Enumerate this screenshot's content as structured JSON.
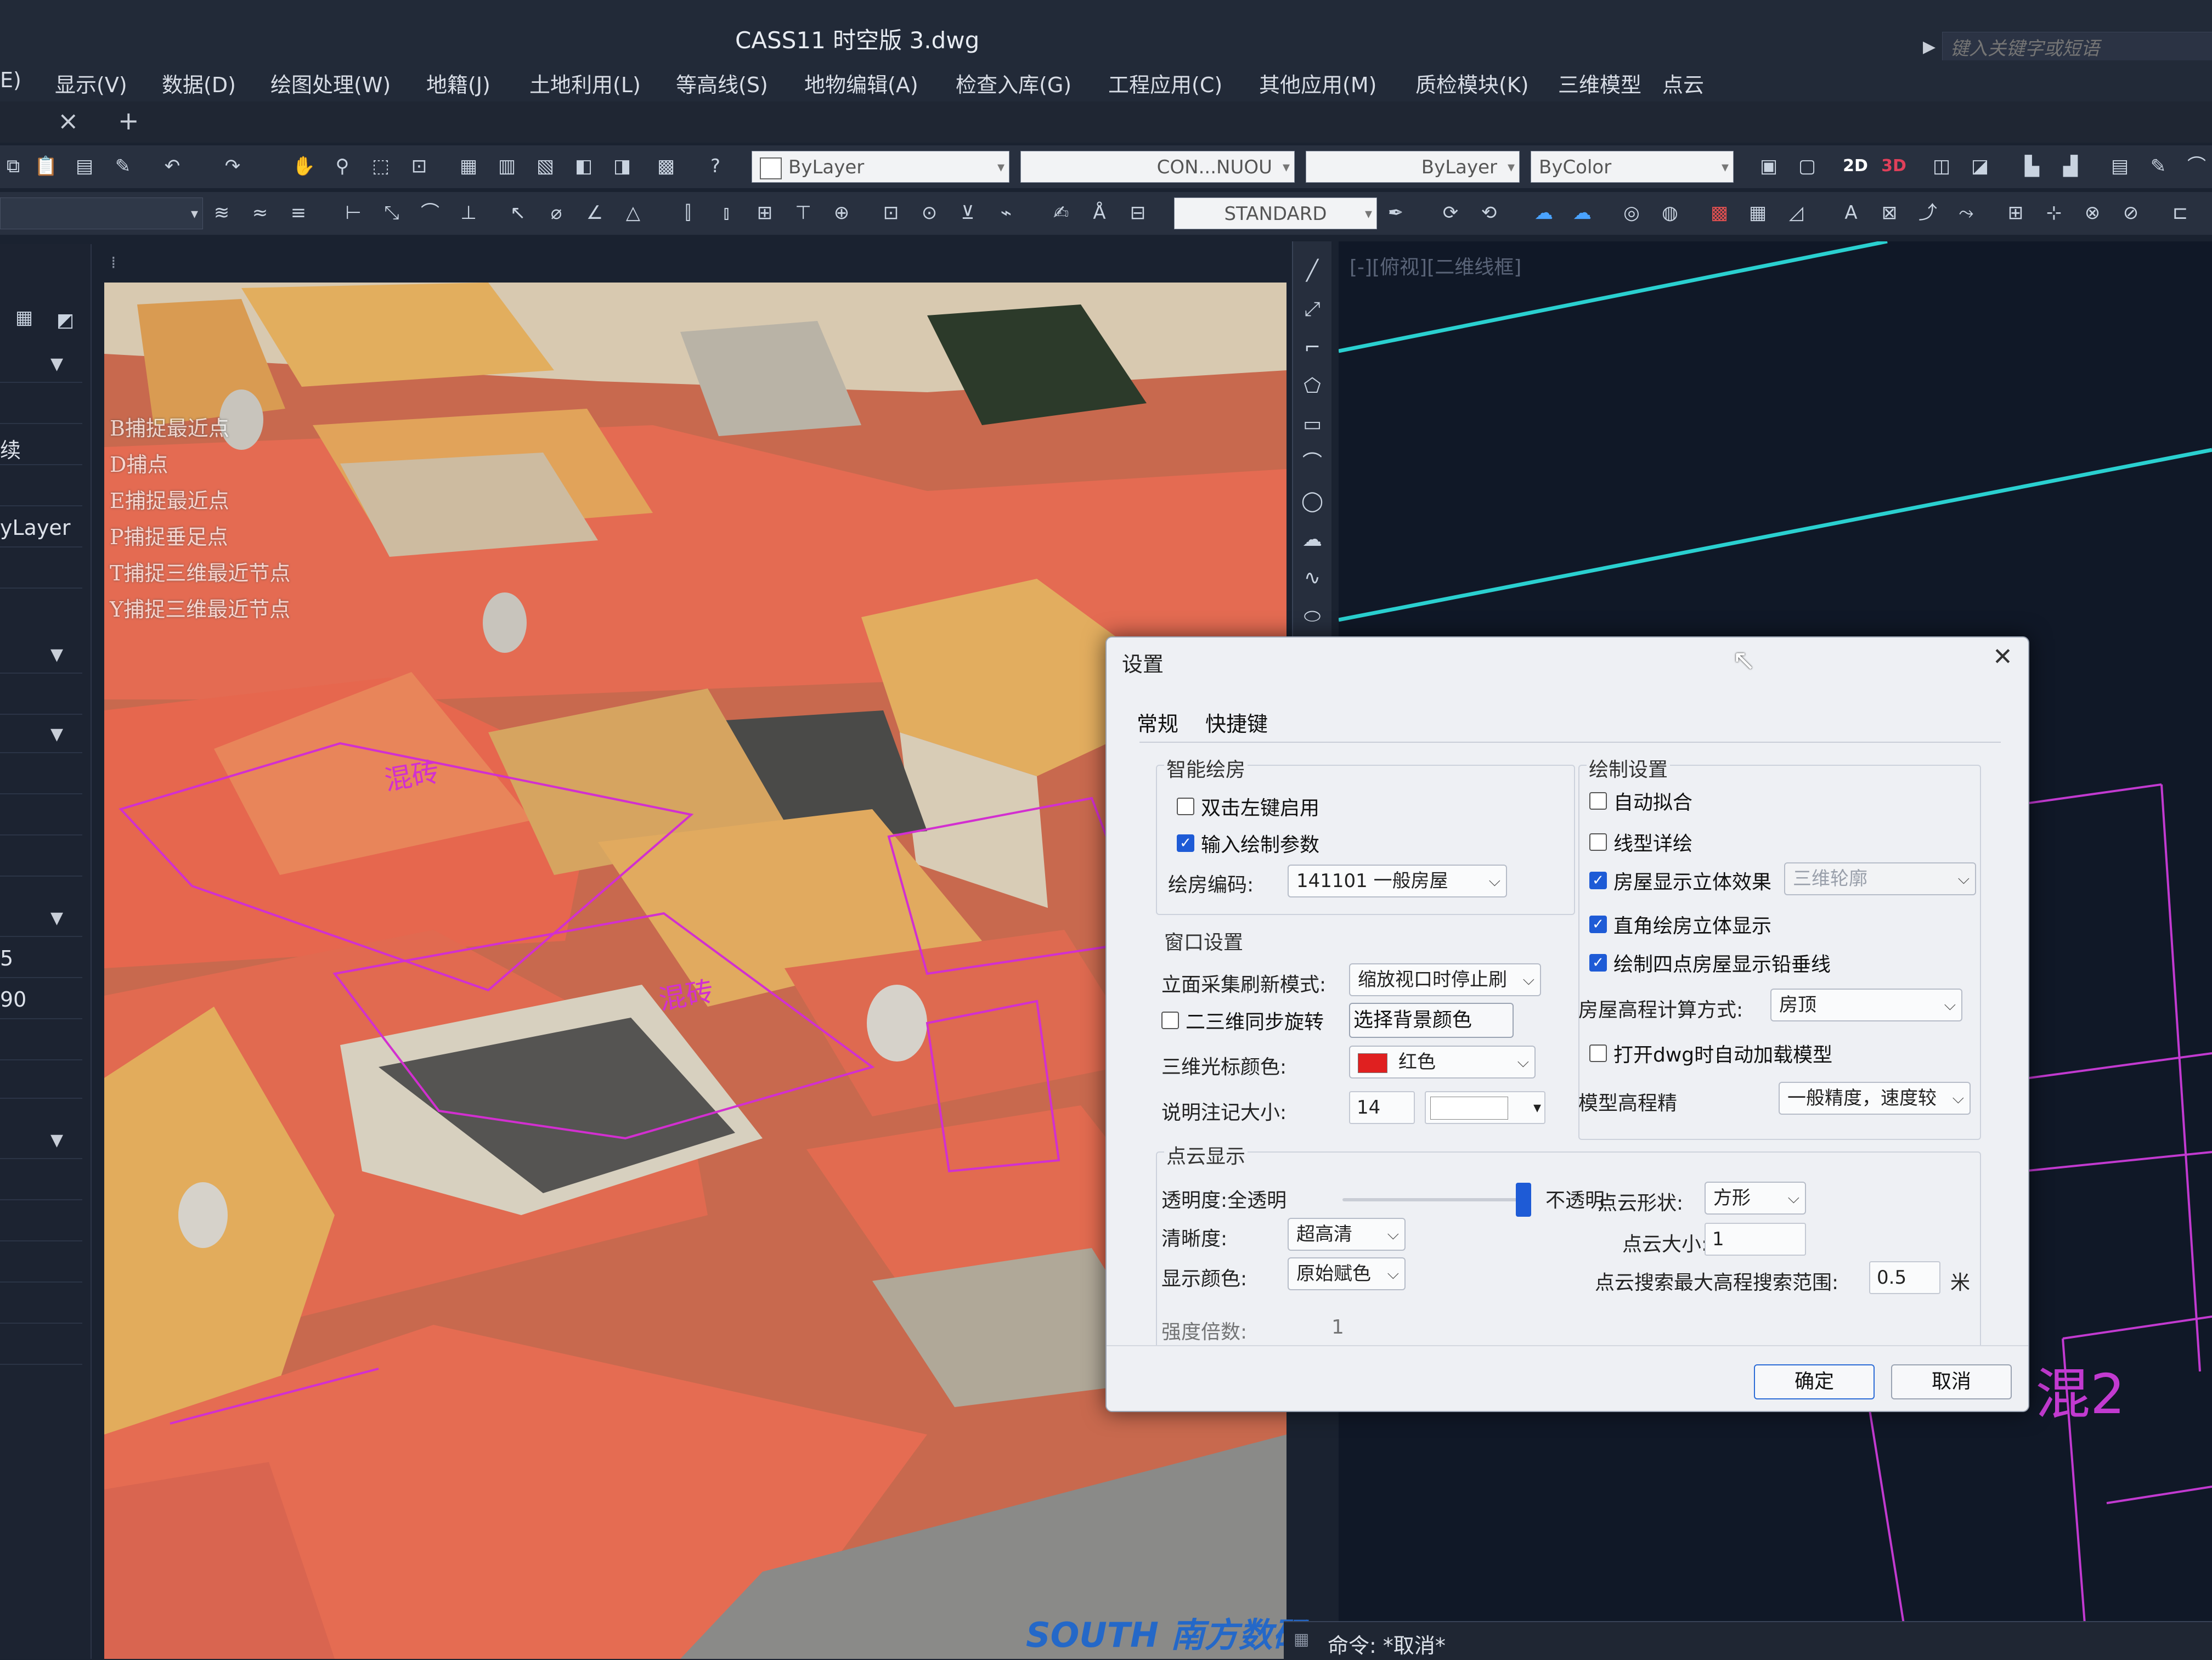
{
  "title": "CASS11 时空版    3.dwg",
  "search": {
    "placeholder": "键入关键字或短语"
  },
  "menu": [
    "E)",
    "显示(V)",
    "数据(D)",
    "绘图处理(W)",
    "地籍(J)",
    "土地利用(L)",
    "等高线(S)",
    "地物编辑(A)",
    "检查入库(G)",
    "工程应用(C)",
    "其他应用(M)",
    "质检模块(K)",
    "三维模型",
    "点云"
  ],
  "tabs": {
    "close": "×",
    "add": "+"
  },
  "toolbar1": {
    "layer": "ByLayer",
    "linetype": "CON...NUOU",
    "lineweight": "ByLayer",
    "color": "ByColor",
    "btn_2d": "2D",
    "btn_3d": "3D"
  },
  "toolbar2": {
    "textstyle": "STANDARD"
  },
  "left_panel": {
    "items": [
      "续",
      "yLayer",
      "5",
      "90"
    ]
  },
  "snap_hints": [
    "B捕捉最近点",
    "D捕点",
    "E捕捉最近点",
    "P捕捉垂足点",
    "T捕捉三维最近节点",
    "Y捕捉三维最近节点"
  ],
  "roof_labels": [
    "混砖",
    "混砖"
  ],
  "viewport2d": {
    "label": "[-][俯视][二维线框]",
    "cad_text": "混2"
  },
  "command": {
    "text": "命令: *取消*"
  },
  "logo": "SOUTH 南方数码",
  "dialog": {
    "title": "设置",
    "tabs": [
      "常规",
      "快捷键"
    ],
    "smart_house": {
      "title": "智能绘房",
      "double_click": "双击左键启用",
      "input_params": "输入绘制参数",
      "code_label": "绘房编码:",
      "code_value": "141101 一般房屋"
    },
    "window": {
      "title": "窗口设置",
      "refresh_label": "立面采集刷新模式:",
      "refresh_value": "缩放视口时停止刷",
      "sync_rotate": "二三维同步旋转",
      "bg_color_btn": "选择背景颜色",
      "cursor_color_label": "三维光标颜色:",
      "cursor_color_value": "红色",
      "cursor_color_hex": "#e02020",
      "note_size_label": "说明注记大小:",
      "note_size_value": "14"
    },
    "drawing": {
      "title": "绘制设置",
      "auto_fit": "自动拟合",
      "linetype_detail": "线型详绘",
      "house_3d": "房屋显示立体效果",
      "house_3d_mode": "三维轮廓",
      "right_angle": "直角绘房立体显示",
      "four_point": "绘制四点房屋显示铅垂线",
      "elev_method_label": "房屋高程计算方式:",
      "elev_method_value": "房顶",
      "auto_load": "打开dwg时自动加载模型",
      "model_precision_label": "模型高程精",
      "model_precision_value": "一般精度，速度较"
    },
    "pointcloud": {
      "title": "点云显示",
      "transparency_label": "透明度:全透明",
      "opaque_label": "不透明",
      "transparency_value": 0.97,
      "clarity_label": "清晰度:",
      "clarity_value": "超高清",
      "color_label": "显示颜色:",
      "color_value": "原始赋色",
      "shape_label": "点云形状:",
      "shape_value": "方形",
      "size_label": "点云大小:",
      "size_value": "1",
      "search_range_label": "点云搜索最大高程搜索范围:",
      "search_range_value": "0.5",
      "search_range_unit": "米",
      "partial_label": "强度倍数:",
      "partial_value": "1"
    },
    "ok": "确定",
    "cancel": "取消"
  },
  "colors": {
    "accent": "#1e5bd6",
    "cad_cyan": "#2ad0d0",
    "cad_magenta": "#c23ad0",
    "roof_red": "#e0604a"
  }
}
